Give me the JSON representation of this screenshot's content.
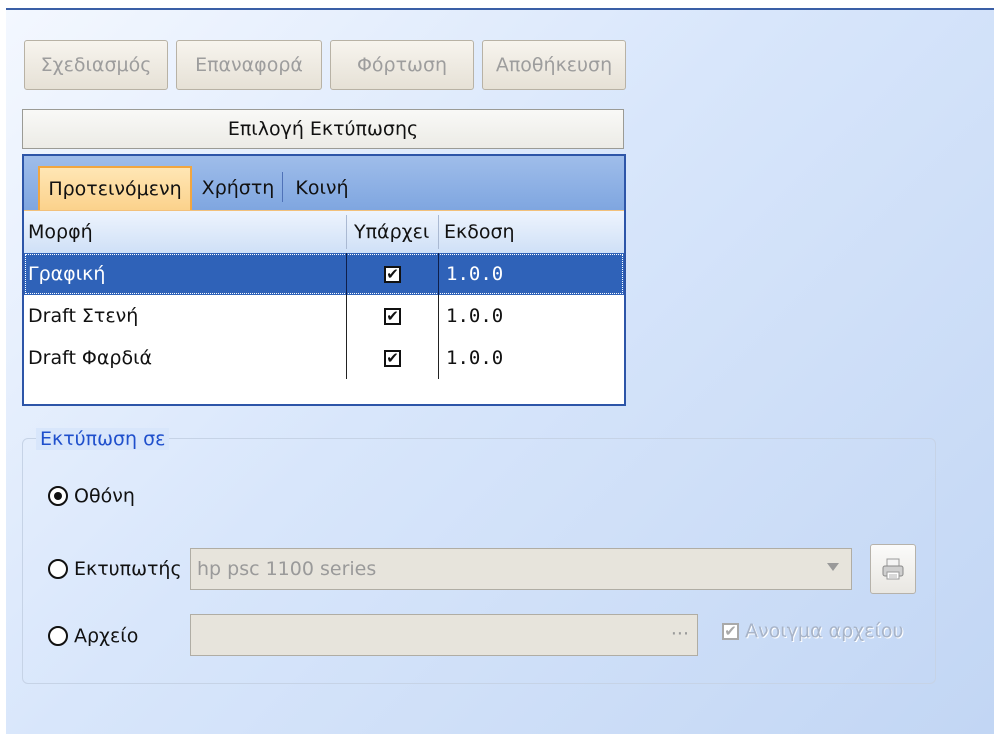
{
  "toolbar": {
    "buttons": [
      {
        "label": "Σχεδιασμός"
      },
      {
        "label": "Επαναφορά"
      },
      {
        "label": "Φόρτωση"
      },
      {
        "label": "Αποθήκευση"
      }
    ]
  },
  "selection_bar": {
    "label": "Επιλογή Εκτύπωσης"
  },
  "tabs": [
    {
      "label": "Προτεινόμενη",
      "active": true
    },
    {
      "label": "Χρήστη",
      "active": false
    },
    {
      "label": "Κοινή",
      "active": false
    }
  ],
  "grid": {
    "columns": [
      "Μορφή",
      "Υπάρχει",
      "Εκδοση"
    ],
    "rows": [
      {
        "format": "Γραφική",
        "exists": true,
        "version": "1.0.0",
        "selected": true
      },
      {
        "format": "Draft Στενή",
        "exists": true,
        "version": "1.0.0",
        "selected": false
      },
      {
        "format": "Draft Φαρδιά",
        "exists": true,
        "version": "1.0.0",
        "selected": false
      }
    ]
  },
  "print_to": {
    "legend": "Εκτύπωση σε",
    "screen_label": "Οθόνη",
    "printer_label": "Εκτυπωτής",
    "file_label": "Αρχείο",
    "selected": "screen",
    "printer_value": "hp psc 1100 series",
    "file_browse": "···",
    "open_file_label": "Ανοιγμα αρχείου",
    "open_file_checked": true
  },
  "icons": {
    "checkmark": "✔",
    "printer": "printer-icon"
  },
  "colors": {
    "selection": "#2f62b8",
    "tab_active": "#fbd28c",
    "legend": "#1e4fcc"
  }
}
